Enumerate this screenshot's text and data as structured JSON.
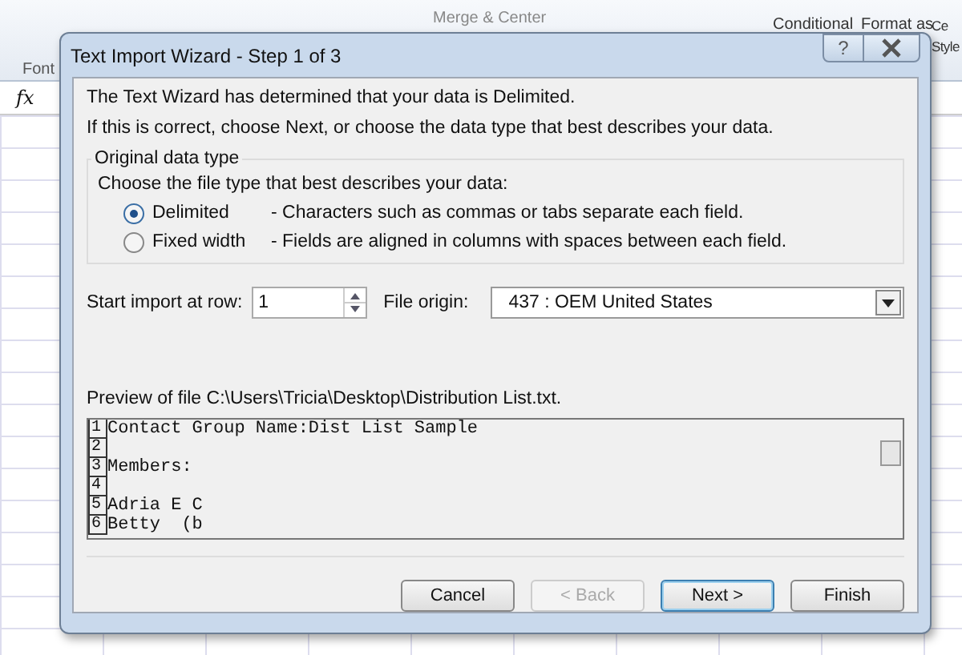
{
  "ribbon": {
    "group_label": "Font",
    "merge_button": "Merge & Center",
    "conditional": "Conditional",
    "format_as": "Format as",
    "cell_styles_top": "Ce",
    "cell_styles_bottom": "Style",
    "formula_icon": "fx"
  },
  "window": {
    "title": "Text Import Wizard - Step 1 of 3",
    "help": "?"
  },
  "intro": [
    "The Text Wizard has determined that your data is Delimited.",
    "If this is correct, choose Next, or choose the data type that best describes your data."
  ],
  "data_type": {
    "legend": "Original data type",
    "prompt": "Choose the file type that best describes your data:",
    "options": [
      {
        "label": "Delimited",
        "description": "- Characters such as commas or tabs separate each field.",
        "selected": true
      },
      {
        "label": "Fixed width",
        "description": "- Fields are aligned in columns with spaces between each field.",
        "selected": false
      }
    ]
  },
  "start_row": {
    "label": "Start import at row:",
    "value": "1"
  },
  "file_origin": {
    "label": "File origin:",
    "value": "437 : OEM United States"
  },
  "preview": {
    "label": "Preview of file C:\\Users\\Tricia\\Desktop\\Distribution List.txt.",
    "lines": [
      {
        "number": "1",
        "text": "Contact Group Name:Dist List Sample"
      },
      {
        "number": "2"
      },
      {
        "number": "3",
        "text": "Members:"
      },
      {
        "number": "4"
      },
      {
        "number": "5",
        "text": "Adria E C"
      },
      {
        "number": "6",
        "text": "Betty  (b"
      }
    ]
  },
  "buttons": [
    {
      "label": "Cancel",
      "disabled": false,
      "default": false
    },
    {
      "label": "< Back",
      "disabled": true,
      "default": false
    },
    {
      "label": "Next >",
      "disabled": false,
      "default": true
    },
    {
      "label": "Finish",
      "disabled": false,
      "default": false
    }
  ]
}
